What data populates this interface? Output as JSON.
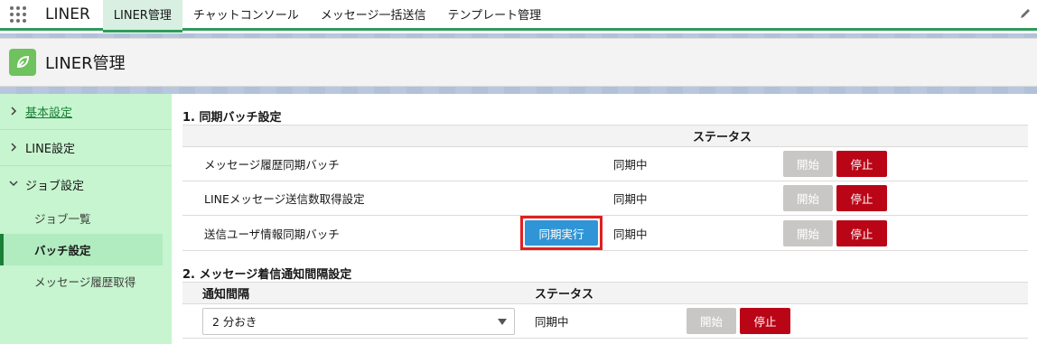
{
  "app": {
    "name": "LINER",
    "launcher_icon": "app-grid-icon"
  },
  "nav": {
    "tabs": [
      {
        "label": "LINER管理",
        "active": true
      },
      {
        "label": "チャットコンソール",
        "active": false
      },
      {
        "label": "メッセージ一括送信",
        "active": false
      },
      {
        "label": "テンプレート管理",
        "active": false
      }
    ],
    "edit_icon": "pencil-icon"
  },
  "header": {
    "title": "LINER管理",
    "icon": "leaf-icon",
    "icon_color": "#6fc25d"
  },
  "sidebar": {
    "items": [
      {
        "label": "基本設定",
        "expanded": false
      },
      {
        "label": "LINE設定",
        "expanded": false
      },
      {
        "label": "ジョブ設定",
        "expanded": true
      }
    ],
    "sub_items": [
      {
        "label": "ジョブ一覧",
        "active": false
      },
      {
        "label": "バッチ設定",
        "active": true
      },
      {
        "label": "メッセージ履歴取得",
        "active": false
      }
    ]
  },
  "section1": {
    "title": "1.  同期バッチ設定",
    "header_status": "ステータス",
    "rows": [
      {
        "name": "メッセージ履歴同期バッチ",
        "status": "同期中",
        "start": "開始",
        "stop": "停止"
      },
      {
        "name": "LINEメッセージ送信数取得設定",
        "status": "同期中",
        "start": "開始",
        "stop": "停止"
      },
      {
        "name": "送信ユーザ情報同期バッチ",
        "status": "同期中",
        "start": "開始",
        "stop": "停止",
        "sync": "同期実行"
      }
    ]
  },
  "section2": {
    "title": "2.  メッセージ着信通知間隔設定",
    "header_interval": "通知間隔",
    "header_status": "ステータス",
    "row": {
      "interval": "2 分おき",
      "status": "同期中",
      "start": "開始",
      "stop": "停止"
    }
  },
  "colors": {
    "accent": "#2e9c5a",
    "stop": "#ba0517",
    "sync": "#2f95d6",
    "highlight": "#e02020"
  }
}
